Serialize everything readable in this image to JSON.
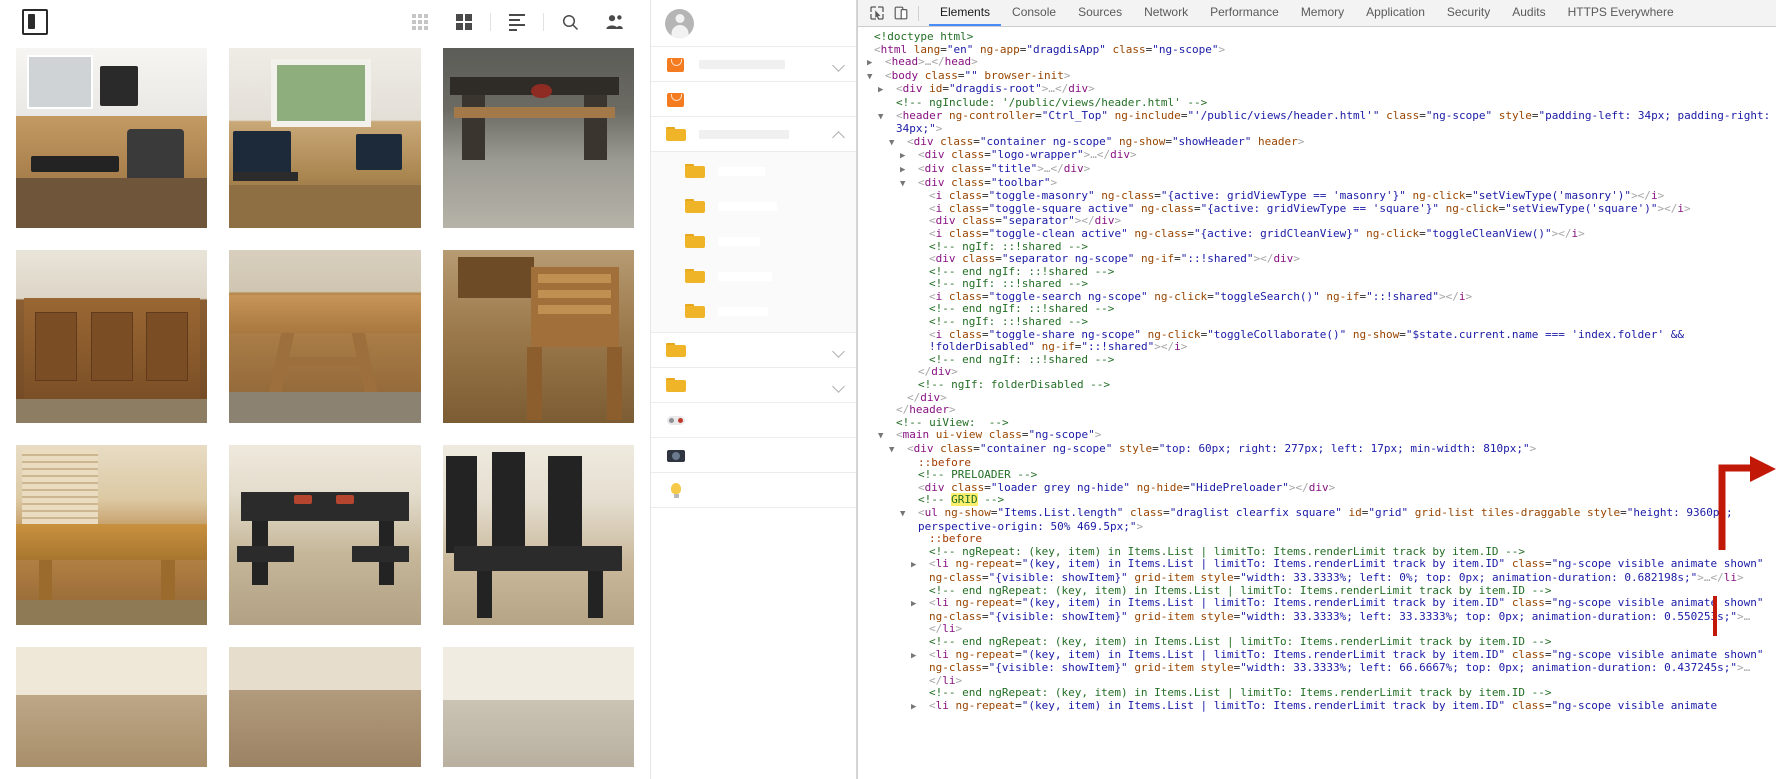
{
  "app": {
    "logo_name": "dragdis-logo",
    "toolbar": {
      "masonry_label": "toggle-masonry",
      "square_label": "toggle-square",
      "clean_label": "toggle-clean",
      "search_label": "toggle-search",
      "share_label": "toggle-share"
    },
    "photos_row1": [
      {
        "name": "desk-wood-slab-office",
        "alt": "Live-edge wooden desk with monitor and keyboard by window"
      },
      {
        "name": "desk-with-laptops-window",
        "alt": "Long wooden desk with two laptops near window"
      },
      {
        "name": "dark-bench-workshop",
        "alt": "Dark stained wooden bench outdoors in workshop"
      }
    ],
    "photos_row2": [
      {
        "name": "wooden-sideboard-cabinet",
        "alt": "Wooden sideboard cabinet with doors"
      },
      {
        "name": "long-dining-table-trestle",
        "alt": "Long wooden trestle dining table"
      },
      {
        "name": "wooden-chair-and-table",
        "alt": "Wooden slatted chair beside table"
      }
    ],
    "photos_row3": [
      {
        "name": "dining-table-bench-window",
        "alt": "Wooden dining table and bench by shuttered window"
      },
      {
        "name": "black-dining-table-benches",
        "alt": "Black dining table with two benches and place settings"
      },
      {
        "name": "black-table-high-back-chairs",
        "alt": "Black dining table with high-back chairs"
      }
    ],
    "photos_row4": [
      {
        "name": "partial-photo-left",
        "alt": "Partially visible photo"
      },
      {
        "name": "partial-photo-middle",
        "alt": "Partially visible photo"
      },
      {
        "name": "partial-photo-right",
        "alt": "Partially visible photo"
      }
    ]
  },
  "folder_panel": {
    "user_avatar_name": "user-avatar",
    "rows": [
      {
        "id": "bag-1",
        "icon": "shopping-bag-icon",
        "label": "",
        "redacted": true,
        "redact_width": 86,
        "chevron": "down",
        "indent": false
      },
      {
        "id": "bag-2",
        "icon": "shopping-bag-icon",
        "label": "",
        "redacted": true,
        "redact_width": 0,
        "chevron": "none",
        "indent": false
      },
      {
        "id": "folder-main",
        "icon": "folder-icon",
        "label": "",
        "redacted": true,
        "redact_width": 90,
        "chevron": "up",
        "indent": false
      },
      {
        "id": "folder-child-1",
        "icon": "folder-icon",
        "label": "",
        "redacted": true,
        "redact_width": 47,
        "chevron": "none",
        "indent": true
      },
      {
        "id": "folder-child-2",
        "icon": "folder-icon",
        "label": "",
        "redacted": true,
        "redact_width": 59,
        "chevron": "none",
        "indent": true
      },
      {
        "id": "folder-child-3",
        "icon": "folder-icon",
        "label": "",
        "redacted": true,
        "redact_width": 42,
        "chevron": "none",
        "indent": true
      },
      {
        "id": "folder-child-4",
        "icon": "folder-icon",
        "label": "",
        "redacted": true,
        "redact_width": 54,
        "chevron": "none",
        "indent": true
      },
      {
        "id": "folder-child-5",
        "icon": "folder-icon",
        "label": "",
        "redacted": true,
        "redact_width": 50,
        "chevron": "none",
        "indent": true
      },
      {
        "id": "folder-b",
        "icon": "folder-icon",
        "label": "",
        "redacted": true,
        "redact_width": 0,
        "chevron": "down",
        "indent": false
      },
      {
        "id": "folder-c",
        "icon": "folder-icon",
        "label": "",
        "redacted": true,
        "redact_width": 0,
        "chevron": "down",
        "indent": false
      },
      {
        "id": "games",
        "icon": "gamepad-icon",
        "label": "",
        "redacted": true,
        "redact_width": 0,
        "chevron": "none",
        "indent": false
      },
      {
        "id": "camera",
        "icon": "camera-icon",
        "label": "",
        "redacted": true,
        "redact_width": 0,
        "chevron": "none",
        "indent": false
      },
      {
        "id": "ideas",
        "icon": "lightbulb-icon",
        "label": "",
        "redacted": true,
        "redact_width": 0,
        "chevron": "none",
        "indent": false
      }
    ]
  },
  "devtools": {
    "inspect_icon": "inspect-element-icon",
    "device_icon": "device-toolbar-icon",
    "tabs": [
      {
        "label": "Elements",
        "active": true
      },
      {
        "label": "Console",
        "active": false
      },
      {
        "label": "Sources",
        "active": false
      },
      {
        "label": "Network",
        "active": false
      },
      {
        "label": "Performance",
        "active": false
      },
      {
        "label": "Memory",
        "active": false
      },
      {
        "label": "Application",
        "active": false
      },
      {
        "label": "Security",
        "active": false
      },
      {
        "label": "Audits",
        "active": false
      },
      {
        "label": "HTTPS Everywhere",
        "active": false
      }
    ],
    "dom_lines": [
      {
        "indent": 0,
        "arrow": "none",
        "html": "<span class=\"cm\">&lt;!doctype html&gt;</span>"
      },
      {
        "indent": 0,
        "arrow": "none",
        "html": "<span class=\"pk\">&lt;</span><span class=\"tg\">html</span> <span class=\"at\">lang</span>=<span class=\"av\">\"en\"</span> <span class=\"at\">ng-app</span>=<span class=\"av\">\"dragdisApp\"</span> <span class=\"at\">class</span>=<span class=\"av\">\"ng-scope\"</span><span class=\"pk\">&gt;</span>"
      },
      {
        "indent": 1,
        "arrow": "closed",
        "html": "<span class=\"pk\">&lt;</span><span class=\"tg\">head</span><span class=\"pk\">&gt;</span><span class=\"pk\">…</span><span class=\"pk\">&lt;/</span><span class=\"tg\">head</span><span class=\"pk\">&gt;</span>"
      },
      {
        "indent": 1,
        "arrow": "open",
        "html": "<span class=\"pk\">&lt;</span><span class=\"tg\">body</span> <span class=\"at\">class</span>=<span class=\"av\">\"</span><span class=\"spacer-body\"></span><span class=\"av\">\"</span> <span class=\"at\">browser-init</span><span class=\"pk\">&gt;</span>"
      },
      {
        "indent": 2,
        "arrow": "closed",
        "html": "<span class=\"pk\">&lt;</span><span class=\"tg\">div</span> <span class=\"at\">id</span>=<span class=\"av\">\"dragdis-root\"</span><span class=\"pk\">&gt;</span><span class=\"pk\">…</span><span class=\"pk\">&lt;/</span><span class=\"tg\">div</span><span class=\"pk\">&gt;</span>"
      },
      {
        "indent": 2,
        "arrow": "none",
        "html": "<span class=\"cm\">&lt;!-- ngInclude: '/public/views/header.html' --&gt;</span>"
      },
      {
        "indent": 2,
        "arrow": "open",
        "html": "<span class=\"pk\">&lt;</span><span class=\"tg\">header</span> <span class=\"at\">ng-controller</span>=<span class=\"av\">\"Ctrl_Top\"</span> <span class=\"at\">ng-include</span>=<span class=\"av\">\"'/public/views/header.html'\"</span> <span class=\"at\">class</span>=<span class=\"av\">\"ng-scope\"</span> <span class=\"at\">style</span>=<span class=\"av\">\"padding-left: 34px; padding-right: 34px;\"</span><span class=\"pk\">&gt;</span>"
      },
      {
        "indent": 3,
        "arrow": "open",
        "html": "<span class=\"pk\">&lt;</span><span class=\"tg\">div</span> <span class=\"at\">class</span>=<span class=\"av\">\"container ng-scope\"</span> <span class=\"at\">ng-show</span>=<span class=\"av\">\"showHeader\"</span> <span class=\"at\">header</span><span class=\"pk\">&gt;</span>"
      },
      {
        "indent": 4,
        "arrow": "closed",
        "html": "<span class=\"pk\">&lt;</span><span class=\"tg\">div</span> <span class=\"at\">class</span>=<span class=\"av\">\"logo-wrapper\"</span><span class=\"pk\">&gt;</span><span class=\"pk\">…</span><span class=\"pk\">&lt;/</span><span class=\"tg\">div</span><span class=\"pk\">&gt;</span>"
      },
      {
        "indent": 4,
        "arrow": "closed",
        "html": "<span class=\"pk\">&lt;</span><span class=\"tg\">div</span> <span class=\"at\">class</span>=<span class=\"av\">\"title\"</span><span class=\"pk\">&gt;</span><span class=\"pk\">…</span><span class=\"pk\">&lt;/</span><span class=\"tg\">div</span><span class=\"pk\">&gt;</span>"
      },
      {
        "indent": 4,
        "arrow": "open",
        "html": "<span class=\"pk\">&lt;</span><span class=\"tg\">div</span> <span class=\"at\">class</span>=<span class=\"av\">\"toolbar\"</span><span class=\"pk\">&gt;</span>"
      },
      {
        "indent": 5,
        "arrow": "none",
        "html": "<span class=\"pk\">&lt;</span><span class=\"tg\">i</span> <span class=\"at\">class</span>=<span class=\"av\">\"toggle-masonry\"</span> <span class=\"at\">ng-class</span>=<span class=\"av\">\"{active: gridViewType == 'masonry'}\"</span> <span class=\"at\">ng-click</span>=<span class=\"av\">\"setViewType('masonry')\"</span><span class=\"pk\">&gt;&lt;/</span><span class=\"tg\">i</span><span class=\"pk\">&gt;</span>"
      },
      {
        "indent": 5,
        "arrow": "none",
        "html": "<span class=\"pk\">&lt;</span><span class=\"tg\">i</span> <span class=\"at\">class</span>=<span class=\"av\">\"toggle-square active\"</span> <span class=\"at\">ng-class</span>=<span class=\"av\">\"{active: gridViewType == 'square'}\"</span> <span class=\"at\">ng-click</span>=<span class=\"av\">\"setViewType('square')\"</span><span class=\"pk\">&gt;&lt;/</span><span class=\"tg\">i</span><span class=\"pk\">&gt;</span>"
      },
      {
        "indent": 5,
        "arrow": "none",
        "html": "<span class=\"pk\">&lt;</span><span class=\"tg\">div</span> <span class=\"at\">class</span>=<span class=\"av\">\"separator\"</span><span class=\"pk\">&gt;&lt;/</span><span class=\"tg\">div</span><span class=\"pk\">&gt;</span>"
      },
      {
        "indent": 5,
        "arrow": "none",
        "html": "<span class=\"pk\">&lt;</span><span class=\"tg\">i</span> <span class=\"at\">class</span>=<span class=\"av\">\"toggle-clean active\"</span> <span class=\"at\">ng-class</span>=<span class=\"av\">\"{active: gridCleanView}\"</span> <span class=\"at\">ng-click</span>=<span class=\"av\">\"toggleCleanView()\"</span><span class=\"pk\">&gt;&lt;/</span><span class=\"tg\">i</span><span class=\"pk\">&gt;</span>"
      },
      {
        "indent": 5,
        "arrow": "none",
        "html": "<span class=\"cm\">&lt;!-- ngIf: ::!shared --&gt;</span>"
      },
      {
        "indent": 5,
        "arrow": "none",
        "html": "<span class=\"pk\">&lt;</span><span class=\"tg\">div</span> <span class=\"at\">class</span>=<span class=\"av\">\"separator ng-scope\"</span> <span class=\"at\">ng-if</span>=<span class=\"av\">\"::!shared\"</span><span class=\"pk\">&gt;&lt;/</span><span class=\"tg\">div</span><span class=\"pk\">&gt;</span>"
      },
      {
        "indent": 5,
        "arrow": "none",
        "html": "<span class=\"cm\">&lt;!-- end ngIf: ::!shared --&gt;</span>"
      },
      {
        "indent": 5,
        "arrow": "none",
        "html": "<span class=\"cm\">&lt;!-- ngIf: ::!shared --&gt;</span>"
      },
      {
        "indent": 5,
        "arrow": "none",
        "html": "<span class=\"pk\">&lt;</span><span class=\"tg\">i</span> <span class=\"at\">class</span>=<span class=\"av\">\"toggle-search ng-scope\"</span> <span class=\"at\">ng-click</span>=<span class=\"av\">\"toggleSearch()\"</span> <span class=\"at\">ng-if</span>=<span class=\"av\">\"::!shared\"</span><span class=\"pk\">&gt;&lt;/</span><span class=\"tg\">i</span><span class=\"pk\">&gt;</span>"
      },
      {
        "indent": 5,
        "arrow": "none",
        "html": "<span class=\"cm\">&lt;!-- end ngIf: ::!shared --&gt;</span>"
      },
      {
        "indent": 5,
        "arrow": "none",
        "html": "<span class=\"cm\">&lt;!-- ngIf: ::!shared --&gt;</span>"
      },
      {
        "indent": 5,
        "arrow": "none",
        "html": "<span class=\"pk\">&lt;</span><span class=\"tg\">i</span> <span class=\"at\">class</span>=<span class=\"av\">\"toggle-share ng-scope\"</span> <span class=\"at\">ng-click</span>=<span class=\"av\">\"toggleCollaborate()\"</span> <span class=\"at\">ng-show</span>=<span class=\"av\">\"$state.current.name === 'index.folder' &amp;&amp; !folderDisabled\"</span> <span class=\"at\">ng-if</span>=<span class=\"av\">\"::!shared\"</span><span class=\"pk\">&gt;&lt;/</span><span class=\"tg\">i</span><span class=\"pk\">&gt;</span>"
      },
      {
        "indent": 5,
        "arrow": "none",
        "html": "<span class=\"cm\">&lt;!-- end ngIf: ::!shared --&gt;</span>"
      },
      {
        "indent": 4,
        "arrow": "none",
        "html": "<span class=\"pk\">&lt;/</span><span class=\"tg\">div</span><span class=\"pk\">&gt;</span>"
      },
      {
        "indent": 4,
        "arrow": "none",
        "html": "<span class=\"cm\">&lt;!-- ngIf: folderDisabled --&gt;</span>"
      },
      {
        "indent": 3,
        "arrow": "none",
        "html": "<span class=\"pk\">&lt;/</span><span class=\"tg\">div</span><span class=\"pk\">&gt;</span>"
      },
      {
        "indent": 2,
        "arrow": "none",
        "html": "<span class=\"pk\">&lt;/</span><span class=\"tg\">header</span><span class=\"pk\">&gt;</span>"
      },
      {
        "indent": 2,
        "arrow": "none",
        "html": "<span class=\"cm\">&lt;!-- uiView:  --&gt;</span>"
      },
      {
        "indent": 2,
        "arrow": "open",
        "html": "<span class=\"pk\">&lt;</span><span class=\"tg\">main</span> <span class=\"at\">ui-view</span> <span class=\"at\">class</span>=<span class=\"av\">\"ng-scope\"</span><span class=\"pk\">&gt;</span>"
      },
      {
        "indent": 3,
        "arrow": "open",
        "html": "<span class=\"pk\">&lt;</span><span class=\"tg\">div</span> <span class=\"at\">class</span>=<span class=\"av\">\"container ng-scope\"</span> <span class=\"at\">style</span>=<span class=\"av\">\"top: 60px; right: 277px; left: 17px; min-width: 810px;\"</span><span class=\"pk\">&gt;</span>"
      },
      {
        "indent": 4,
        "arrow": "none",
        "html": "<span class=\"ps\">::before</span>"
      },
      {
        "indent": 4,
        "arrow": "none",
        "html": "<span class=\"cm\">&lt;!-- PRELOADER --&gt;</span>"
      },
      {
        "indent": 4,
        "arrow": "none",
        "html": "<span class=\"pk\">&lt;</span><span class=\"tg\">div</span> <span class=\"at\">class</span>=<span class=\"av\">\"loader grey ng-hide\"</span> <span class=\"at\">ng-hide</span>=<span class=\"av\">\"HidePreloader\"</span><span class=\"pk\">&gt;&lt;/</span><span class=\"tg\">div</span><span class=\"pk\">&gt;</span>"
      },
      {
        "indent": 4,
        "arrow": "none",
        "html": "<span class=\"cm\">&lt;!-- <span class=\"hl\">GRID</span> --&gt;</span>"
      },
      {
        "indent": 4,
        "arrow": "open",
        "html": "<span class=\"pk\">&lt;</span><span class=\"tg\">ul</span> <span class=\"at\">ng-show</span>=<span class=\"av\">\"Items.List.length\"</span> <span class=\"at\">class</span>=<span class=\"av\">\"draglist clearfix square\"</span> <span class=\"at\">id</span>=<span class=\"av\">\"grid\"</span> <span class=\"at\">grid-list</span> <span class=\"at\">tiles-draggable</span> <span class=\"at\">style</span>=<span class=\"av\">\"height: 9360px; perspective-origin: 50% 469.5px;\"</span><span class=\"pk\">&gt;</span>"
      },
      {
        "indent": 5,
        "arrow": "none",
        "html": "<span class=\"ps\">::before</span>"
      },
      {
        "indent": 5,
        "arrow": "none",
        "html": "<span class=\"cm\">&lt;!-- ngRepeat: (key, item) in Items.List | limitTo: Items.renderLimit track by item.ID --&gt;</span>"
      },
      {
        "indent": 5,
        "arrow": "closed",
        "html": "<span class=\"pk\">&lt;</span><span class=\"tg\">li</span> <span class=\"at\">ng-repeat</span>=<span class=\"av\">\"(key, item) in Items.List | limitTo: Items.renderLimit track by item.ID\"</span> <span class=\"at\">class</span>=<span class=\"av\">\"ng-scope visible animate shown\"</span> <span class=\"at\">ng-class</span>=<span class=\"av\">\"{visible: showItem}\"</span> <span class=\"at\">grid-item</span> <span class=\"at\">style</span>=<span class=\"av\">\"width: 33.3333%; left: 0%; top: 0px; animation-duration: 0.682198s;\"</span><span class=\"pk\">&gt;</span><span class=\"pk\">…</span><span class=\"pk\">&lt;/</span><span class=\"tg\">li</span><span class=\"pk\">&gt;</span>"
      },
      {
        "indent": 5,
        "arrow": "none",
        "html": "<span class=\"cm\">&lt;!-- end ngRepeat: (key, item) in Items.List | limitTo: Items.renderLimit track by item.ID --&gt;</span>"
      },
      {
        "indent": 5,
        "arrow": "closed",
        "html": "<span class=\"pk\">&lt;</span><span class=\"tg\">li</span> <span class=\"at\">ng-repeat</span>=<span class=\"av\">\"(key, item) in Items.List | limitTo: Items.renderLimit track by item.ID\"</span> <span class=\"at\">class</span>=<span class=\"av\">\"ng-scope visible animate shown\"</span> <span class=\"at\">ng-class</span>=<span class=\"av\">\"{visible: showItem}\"</span> <span class=\"at\">grid-item</span> <span class=\"at\">style</span>=<span class=\"av\">\"width: 33.3333%; left: 33.3333%; top: 0px; animation-duration: 0.550253s;\"</span><span class=\"pk\">&gt;</span><span class=\"pk\">…</span><span class=\"pk\">&lt;/</span><span class=\"tg\">li</span><span class=\"pk\">&gt;</span>"
      },
      {
        "indent": 5,
        "arrow": "none",
        "html": "<span class=\"cm\">&lt;!-- end ngRepeat: (key, item) in Items.List | limitTo: Items.renderLimit track by item.ID --&gt;</span>"
      },
      {
        "indent": 5,
        "arrow": "closed",
        "html": "<span class=\"pk\">&lt;</span><span class=\"tg\">li</span> <span class=\"at\">ng-repeat</span>=<span class=\"av\">\"(key, item) in Items.List | limitTo: Items.renderLimit track by item.ID\"</span> <span class=\"at\">class</span>=<span class=\"av\">\"ng-scope visible animate shown\"</span> <span class=\"at\">ng-class</span>=<span class=\"av\">\"{visible: showItem}\"</span> <span class=\"at\">grid-item</span> <span class=\"at\">style</span>=<span class=\"av\">\"width: 33.3333%; left: 66.6667%; top: 0px; animation-duration: 0.437245s;\"</span><span class=\"pk\">&gt;</span><span class=\"pk\">…</span><span class=\"pk\">&lt;/</span><span class=\"tg\">li</span><span class=\"pk\">&gt;</span>"
      },
      {
        "indent": 5,
        "arrow": "none",
        "html": "<span class=\"cm\">&lt;!-- end ngRepeat: (key, item) in Items.List | limitTo: Items.renderLimit track by item.ID --&gt;</span>"
      },
      {
        "indent": 5,
        "arrow": "closed",
        "html": "<span class=\"pk\">&lt;</span><span class=\"tg\">li</span> <span class=\"at\">ng-repeat</span>=<span class=\"av\">\"(key, item) in Items.List | limitTo: Items.renderLimit track by item.ID\"</span> <span class=\"at\">class</span>=<span class=\"av\">\"ng-scope visible animate</span>"
      }
    ],
    "annotation": {
      "arrow_name": "red-annotation-arrow",
      "arrow_color": "#c21807",
      "points_to": "GRID"
    }
  }
}
